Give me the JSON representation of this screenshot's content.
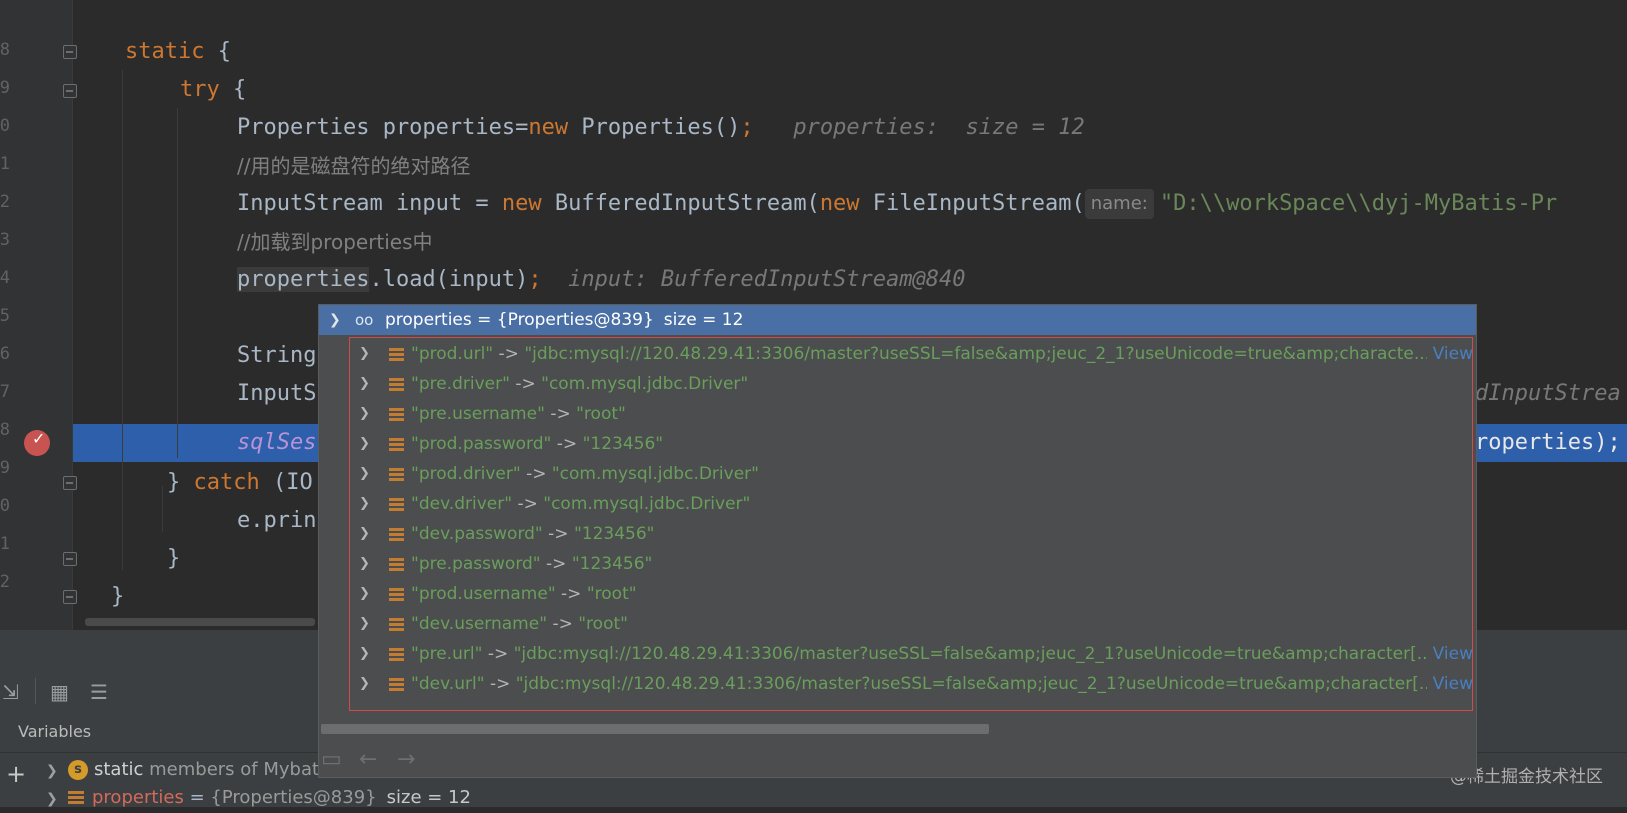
{
  "editor": {
    "line_numbers": [
      "8",
      "9",
      "0",
      "1",
      "2",
      "3",
      "4",
      "5",
      "6",
      "7",
      "8",
      "9",
      "0",
      "1",
      "2"
    ],
    "lines": {
      "l1": {
        "kw": "static",
        "rest": " {"
      },
      "l2": {
        "kw": "try",
        "rest": " {"
      },
      "l3": {
        "a": "Properties properties=",
        "kw": "new",
        "b": " Properties()",
        "semi": ";",
        "hint": "properties:  size = 12"
      },
      "l4": {
        "comment": "//用的是磁盘符的绝对路径"
      },
      "l5": {
        "a": "InputStream input = ",
        "kw1": "new",
        "b": " BufferedInputStream(",
        "kw2": "new",
        "c": " FileInputStream(",
        "param": "name:",
        "str": "\"D:\\\\workSpace\\\\dyj-MyBatis-Pr"
      },
      "l6": {
        "comment": "//加载到properties中"
      },
      "l7": {
        "ref": "properties",
        "a": ".load(input)",
        "semi": ";",
        "hint": "input: BufferedInputStream@840"
      },
      "l9": {
        "a": "String"
      },
      "l10": {
        "a": "InputS",
        "tail": "dInputStrea"
      },
      "l11": {
        "a": "sqlSes",
        "tail": "roperties);"
      },
      "l12": {
        "brace": "} ",
        "kw": "catch",
        "rest": " (IO"
      },
      "l13": {
        "a": "e.prin"
      },
      "l14": {
        "a": "}"
      },
      "l15": {
        "a": "}"
      }
    }
  },
  "popup": {
    "header": {
      "name": "properties = {Properties@839}",
      "size": "size = 12"
    },
    "rows": [
      {
        "key": "\"prod.url\"",
        "arrow": "->",
        "value": "\"jdbc:mysql://120.48.29.41:3306/master?useSSL=false&amp;jeuc_2_1?useUnicode=true&amp;characte...",
        "view": "View"
      },
      {
        "key": "\"pre.driver\"",
        "arrow": "->",
        "value": "\"com.mysql.jdbc.Driver\""
      },
      {
        "key": "\"pre.username\"",
        "arrow": "->",
        "value": "\"root\""
      },
      {
        "key": "\"prod.password\"",
        "arrow": "->",
        "value": "\"123456\""
      },
      {
        "key": "\"prod.driver\"",
        "arrow": "->",
        "value": "\"com.mysql.jdbc.Driver\""
      },
      {
        "key": "\"dev.driver\"",
        "arrow": "->",
        "value": "\"com.mysql.jdbc.Driver\""
      },
      {
        "key": "\"dev.password\"",
        "arrow": "->",
        "value": "\"123456\""
      },
      {
        "key": "\"pre.password\"",
        "arrow": "->",
        "value": "\"123456\""
      },
      {
        "key": "\"prod.username\"",
        "arrow": "->",
        "value": "\"root\""
      },
      {
        "key": "\"dev.username\"",
        "arrow": "->",
        "value": "\"root\""
      },
      {
        "key": "\"pre.url\"",
        "arrow": "->",
        "value": "\"jdbc:mysql://120.48.29.41:3306/master?useSSL=false&amp;jeuc_2_1?useUnicode=true&amp;character[...",
        "view": "View"
      },
      {
        "key": "\"dev.url\"",
        "arrow": "->",
        "value": "\"jdbc:mysql://120.48.29.41:3306/master?useSSL=false&amp;jeuc_2_1?useUnicode=true&amp;character[...",
        "view": "View"
      }
    ],
    "footer_icons": [
      "folder-icon",
      "back-arrow-icon",
      "forward-arrow-icon"
    ]
  },
  "debugger": {
    "variables_label": "Variables",
    "static_row": {
      "badge": "s",
      "kw": "static",
      "text": " members of Mybat"
    },
    "properties_row": {
      "name": "properties",
      "eq": " = ",
      "value": "{Properties@839}",
      "size": "size = 12"
    }
  },
  "watermark": "@稀土掘金技术社区",
  "colors": {
    "keyword": "#cc7832",
    "string": "#6a8759",
    "exec_line": "#2d5faa",
    "popup_header": "#4a6fa5",
    "breakpoint": "#c75450"
  }
}
